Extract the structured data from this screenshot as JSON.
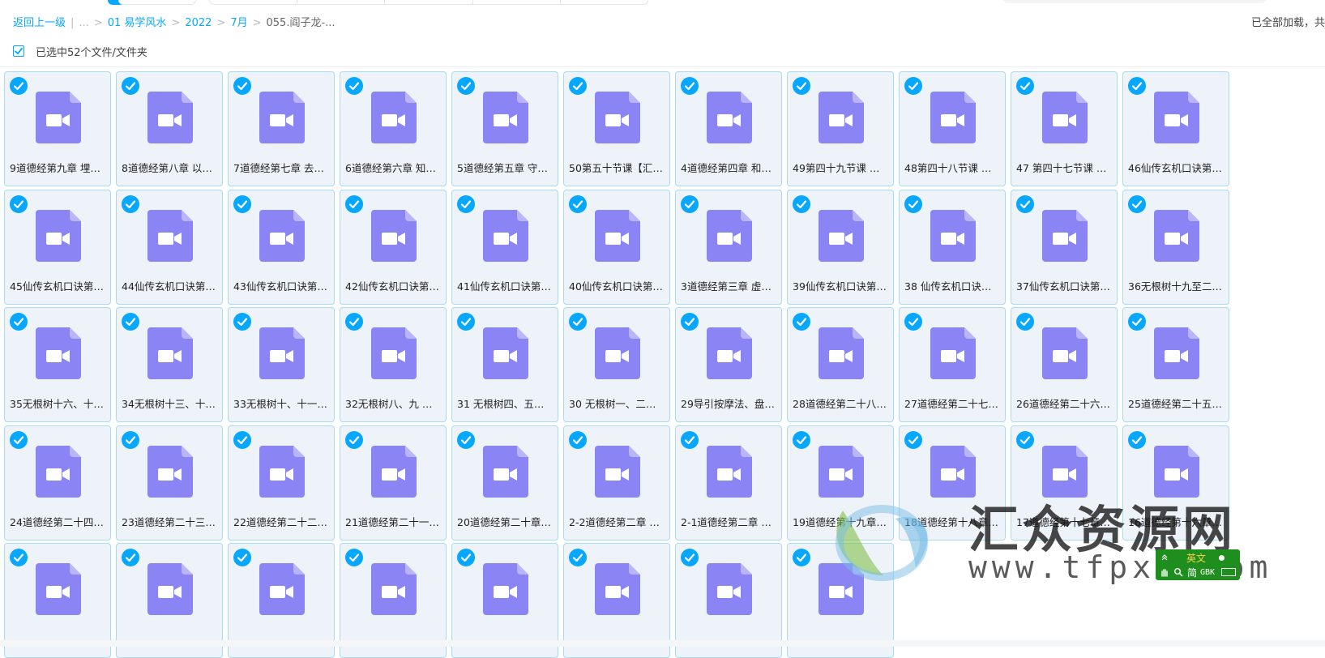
{
  "breadcrumb": {
    "back": "返回上一级",
    "ellipsis": "...",
    "items": [
      "01 易学风水",
      "2022",
      "7月"
    ],
    "current": "055.阎子龙-..."
  },
  "load_status": "已全部加载，共",
  "selection": {
    "label": "已选中52个文件/文件夹",
    "checked": true
  },
  "files": [
    "9道德经第九章 埋…",
    "8道德经第八章 以…",
    "7道德经第七章 去…",
    "6道德经第六章 知…",
    "5道德经第五章 守…",
    "50第五十节课【汇…",
    "4道德经第四章 和…",
    "49第四十九节课 …",
    "48第四十八节课 …",
    "47 第四十七节课 …",
    "46仙传玄机口诀第…",
    "45仙传玄机口诀第…",
    "44仙传玄机口诀第…",
    "43仙传玄机口诀第…",
    "42仙传玄机口诀第…",
    "41仙传玄机口诀第…",
    "40仙传玄机口诀第…",
    "3道德经第三章 虚…",
    "39仙传玄机口诀第…",
    "38 仙传玄机口诀…",
    "37仙传玄机口诀第…",
    "36无根树十九至二…",
    "35无根树十六、十…",
    "34无根树十三、十…",
    "33无根树十、十一…",
    "32无根树八、九 …",
    "31 无根树四、五…",
    "30 无根树一、二…",
    "29导引按摩法、盘…",
    "28道德经第二十八…",
    "27道德经第二十七…",
    "26道德经第二十六…",
    "25道德经第二十五…",
    "24道德经第二十四…",
    "23道德经第二十三…",
    "22道德经第二十二…",
    "21道德经第二十一…",
    "20道德经第二十章…",
    "2-2道德经第二章 …",
    "2-1道德经第二章 …",
    "19道德经第十九章…",
    "18道德经第十八章…",
    "17道德经第十七章…",
    "16道德经第十六章…",
    "",
    "",
    "",
    "",
    "",
    "",
    "",
    ""
  ],
  "watermark": {
    "text": "汇众资源网",
    "url": "www.tfpxw.com"
  },
  "ime": {
    "lang": "英文",
    "mode": "简",
    "encoding": "GBK"
  },
  "colors": {
    "accent": "#06a7ff",
    "file_icon": "#8b84f5",
    "tile_bg": "#eef2f9",
    "tile_border": "#a7dcf3"
  }
}
